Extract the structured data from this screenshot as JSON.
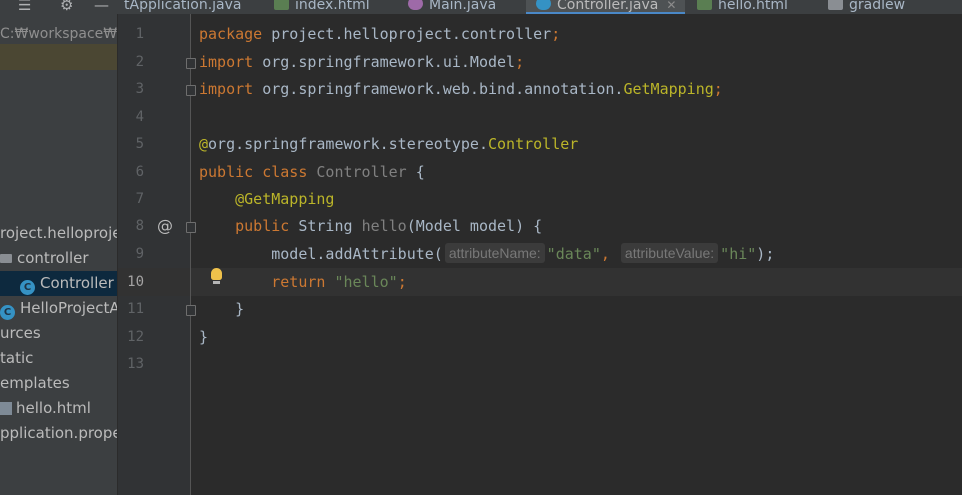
{
  "toolbar": {
    "icons": [
      "collapse-all-icon",
      "settings-icon",
      "hide-icon"
    ]
  },
  "tabs": [
    {
      "label": "tApplication.java",
      "icon": "java-class-icon",
      "active": false
    },
    {
      "label": "index.html",
      "icon": "html-file-icon",
      "active": false
    },
    {
      "label": "Main.java",
      "icon": "run-class-icon",
      "active": false
    },
    {
      "label": "Controller.java",
      "icon": "java-class-icon",
      "active": true,
      "close": "✕"
    },
    {
      "label": "hello.html",
      "icon": "html-file-icon",
      "active": false
    },
    {
      "label": "gradlew",
      "icon": "script-file-icon",
      "active": false
    }
  ],
  "project": {
    "path": "C:₩workspace₩h",
    "tree": [
      {
        "label": "roject.helloprojec",
        "icon": "none"
      },
      {
        "label": "controller",
        "icon": "folder-icon"
      },
      {
        "label": "Controller",
        "icon": "java-class-icon",
        "selected": true
      },
      {
        "label": "HelloProjectAp",
        "icon": "spring-class-icon"
      },
      {
        "label": "urces",
        "icon": "none"
      },
      {
        "label": "tatic",
        "icon": "none"
      },
      {
        "label": "emplates",
        "icon": "none"
      },
      {
        "label": "hello.html",
        "icon": "html-file-icon"
      },
      {
        "label": "pplication.proper",
        "icon": "none"
      }
    ]
  },
  "editor": {
    "current_line": 10,
    "line_numbers": [
      "1",
      "2",
      "3",
      "4",
      "5",
      "6",
      "7",
      "8",
      "9",
      "10",
      "11",
      "12",
      "13"
    ],
    "code": {
      "l1_kw": "package",
      "l1_rest": " project.helloproject.controller",
      "l1_semi": ";",
      "l2_kw": "import",
      "l2_rest": " org.springframework.ui.Model",
      "l2_semi": ";",
      "l3_kw": "import",
      "l3_rest": " org.springframework.web.bind.annotation.",
      "l3_ann": "GetMapping",
      "l3_semi": ";",
      "l5_at": "@",
      "l5_rest": "org.springframework.stereotype.",
      "l5_ann": "Controller",
      "l6_kw": "public class",
      "l6_name": " Controller",
      "l6_rest": " {",
      "l7_indent": "    ",
      "l7_ann": "@GetMapping",
      "l8_indent": "    ",
      "l8_kw": "public",
      "l8_type": " String ",
      "l8_name": "hello",
      "l8_rest": "(Model model) {",
      "l9_indent": "        ",
      "l9_pre": "model.addAttribute(",
      "l9_hint1": "attributeName:",
      "l9_str1": "\"data\"",
      "l9_comma": ",",
      "l9_hint2": "attributeValue:",
      "l9_str2": "\"hi\"",
      "l9_post": ");",
      "l10_indent": "        ",
      "l10_kw": "return",
      "l10_str": " \"hello\"",
      "l10_semi": ";",
      "l11": "    }",
      "l12": "}"
    }
  },
  "colors": {
    "keyword": "#cc7832",
    "annotation": "#bbb529",
    "string": "#6a8759",
    "text": "#a9b7c6",
    "background": "#2b2b2b"
  }
}
